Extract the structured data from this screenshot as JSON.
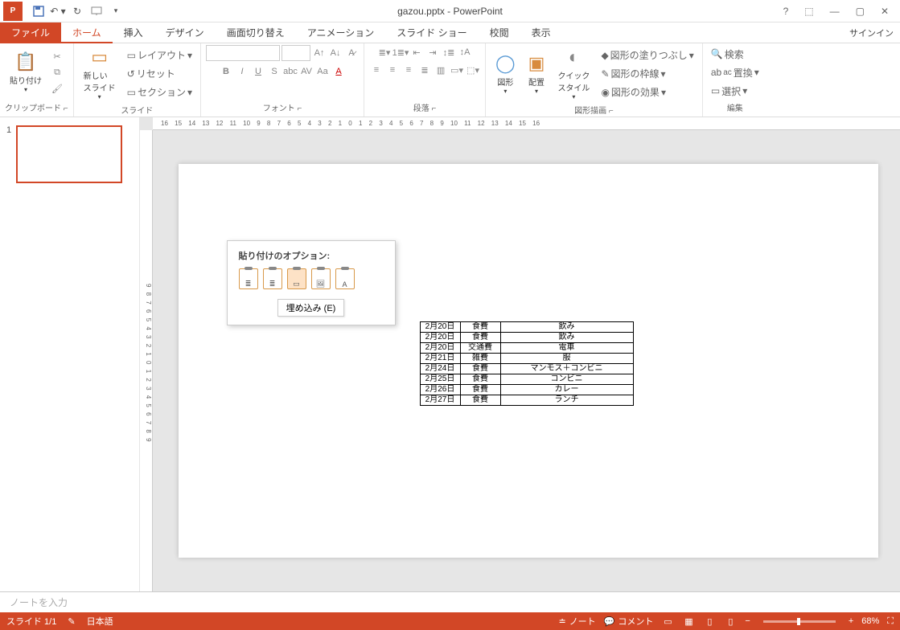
{
  "app": {
    "title": "gazou.pptx - PowerPoint",
    "icon_label": "P"
  },
  "qat": {
    "save": "保存",
    "undo": "元に戻す",
    "redo": "やり直し",
    "start": "最初から"
  },
  "win": {
    "help": "?",
    "ribbon": "⬚",
    "min": "—",
    "max": "▢",
    "close": "✕"
  },
  "tabs": {
    "file": "ファイル",
    "home": "ホーム",
    "insert": "挿入",
    "design": "デザイン",
    "transition": "画面切り替え",
    "animation": "アニメーション",
    "slideshow": "スライド ショー",
    "review": "校閲",
    "view": "表示",
    "signin": "サインイン"
  },
  "ribbon": {
    "clipboard": {
      "label": "クリップボード",
      "paste": "貼り付け"
    },
    "slides": {
      "label": "スライド",
      "new": "新しい\nスライド",
      "layout": "レイアウト",
      "reset": "リセット",
      "section": "セクション"
    },
    "font": {
      "label": "フォント"
    },
    "paragraph": {
      "label": "段落"
    },
    "drawing": {
      "label": "図形描画",
      "shapes": "図形",
      "arrange": "配置",
      "quick": "クイック\nスタイル",
      "fill": "図形の塗りつぶし",
      "outline": "図形の枠線",
      "effects": "図形の効果"
    },
    "editing": {
      "label": "編集",
      "find": "検索",
      "replace": "置換",
      "select": "選択"
    }
  },
  "ruler_h": "16   15   14   13   12   11   10   9   8   7   6   5   4   3   2   1   0   1   2   3   4   5   6   7   8   9   10   11   12   13   14   15   16",
  "ruler_v": "9  8  7  6  5  4  3  2  1  0  1  2  3  4  5  6  7  8  9",
  "thumbs": {
    "num": "1"
  },
  "popup": {
    "title": "貼り付けのオプション:",
    "embed": "埋め込み (E)"
  },
  "table": {
    "rows": [
      {
        "date": "2月20日",
        "cat": "食費",
        "desc": "飲み"
      },
      {
        "date": "2月20日",
        "cat": "食費",
        "desc": "飲み"
      },
      {
        "date": "2月20日",
        "cat": "交通費",
        "desc": "電車"
      },
      {
        "date": "2月21日",
        "cat": "雑費",
        "desc": "服"
      },
      {
        "date": "2月24日",
        "cat": "食費",
        "desc": "マンモス＋コンビニ"
      },
      {
        "date": "2月25日",
        "cat": "食費",
        "desc": "コンビニ"
      },
      {
        "date": "2月26日",
        "cat": "食費",
        "desc": "カレー"
      },
      {
        "date": "2月27日",
        "cat": "食費",
        "desc": "ランチ"
      }
    ]
  },
  "notes": {
    "placeholder": "ノートを入力"
  },
  "status": {
    "slide": "スライド 1/1",
    "lang": "日本語",
    "notes": "ノート",
    "comments": "コメント",
    "zoom": "68%"
  }
}
